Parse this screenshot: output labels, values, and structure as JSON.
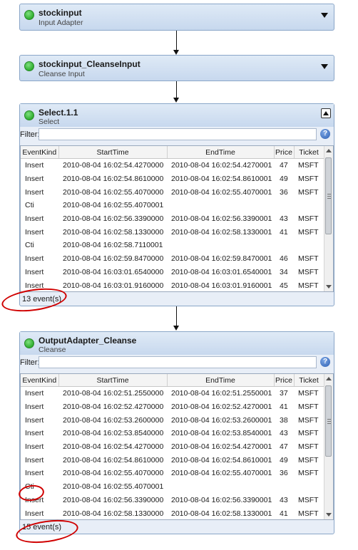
{
  "nodes": [
    {
      "title": "stockinput",
      "subtitle": "Input Adapter"
    },
    {
      "title": "stockinput_CleanseInput",
      "subtitle": "Cleanse Input"
    }
  ],
  "panels": [
    {
      "title": "Select.1.1",
      "subtitle": "Select",
      "filter_label": "Filter:",
      "filter_value": "",
      "columns": [
        "EventKind",
        "StartTime",
        "EndTime",
        "Price",
        "Ticket"
      ],
      "rows": [
        [
          "Insert",
          "2010-08-04 16:02:54.4270000",
          "2010-08-04 16:02:54.4270001",
          "47",
          "MSFT"
        ],
        [
          "Insert",
          "2010-08-04 16:02:54.8610000",
          "2010-08-04 16:02:54.8610001",
          "49",
          "MSFT"
        ],
        [
          "Insert",
          "2010-08-04 16:02:55.4070000",
          "2010-08-04 16:02:55.4070001",
          "36",
          "MSFT"
        ],
        [
          "Cti",
          "2010-08-04 16:02:55.4070001",
          "",
          "",
          ""
        ],
        [
          "Insert",
          "2010-08-04 16:02:56.3390000",
          "2010-08-04 16:02:56.3390001",
          "43",
          "MSFT"
        ],
        [
          "Insert",
          "2010-08-04 16:02:58.1330000",
          "2010-08-04 16:02:58.1330001",
          "41",
          "MSFT"
        ],
        [
          "Cti",
          "2010-08-04 16:02:58.7110001",
          "",
          "",
          ""
        ],
        [
          "Insert",
          "2010-08-04 16:02:59.8470000",
          "2010-08-04 16:02:59.8470001",
          "46",
          "MSFT"
        ],
        [
          "Insert",
          "2010-08-04 16:03:01.6540000",
          "2010-08-04 16:03:01.6540001",
          "34",
          "MSFT"
        ],
        [
          "Insert",
          "2010-08-04 16:03:01.9160000",
          "2010-08-04 16:03:01.9160001",
          "45",
          "MSFT"
        ]
      ],
      "status": "13 event(s)"
    },
    {
      "title": "OutputAdapter_Cleanse",
      "subtitle": "Cleanse",
      "filter_label": "Filter:",
      "filter_value": "",
      "columns": [
        "EventKind",
        "StartTime",
        "EndTime",
        "Price",
        "Ticket"
      ],
      "rows": [
        [
          "Insert",
          "2010-08-04 16:02:51.2550000",
          "2010-08-04 16:02:51.2550001",
          "37",
          "MSFT"
        ],
        [
          "Insert",
          "2010-08-04 16:02:52.4270000",
          "2010-08-04 16:02:52.4270001",
          "41",
          "MSFT"
        ],
        [
          "Insert",
          "2010-08-04 16:02:53.2600000",
          "2010-08-04 16:02:53.2600001",
          "38",
          "MSFT"
        ],
        [
          "Insert",
          "2010-08-04 16:02:53.8540000",
          "2010-08-04 16:02:53.8540001",
          "43",
          "MSFT"
        ],
        [
          "Insert",
          "2010-08-04 16:02:54.4270000",
          "2010-08-04 16:02:54.4270001",
          "47",
          "MSFT"
        ],
        [
          "Insert",
          "2010-08-04 16:02:54.8610000",
          "2010-08-04 16:02:54.8610001",
          "49",
          "MSFT"
        ],
        [
          "Insert",
          "2010-08-04 16:02:55.4070000",
          "2010-08-04 16:02:55.4070001",
          "36",
          "MSFT"
        ],
        [
          "Cti",
          "2010-08-04 16:02:55.4070001",
          "",
          "",
          ""
        ],
        [
          "Insert",
          "2010-08-04 16:02:56.3390000",
          "2010-08-04 16:02:56.3390001",
          "43",
          "MSFT"
        ],
        [
          "Insert",
          "2010-08-04 16:02:58.1330000",
          "2010-08-04 16:02:58.1330001",
          "41",
          "MSFT"
        ]
      ],
      "status": "15 event(s)"
    }
  ],
  "colors": {
    "annotation": "#d00000",
    "panel_border": "#8aa6c8",
    "status_green": "#2fae2f"
  },
  "icons": [
    "status-dot-icon",
    "chevron-down-icon",
    "collapse-up-icon",
    "help-icon"
  ]
}
